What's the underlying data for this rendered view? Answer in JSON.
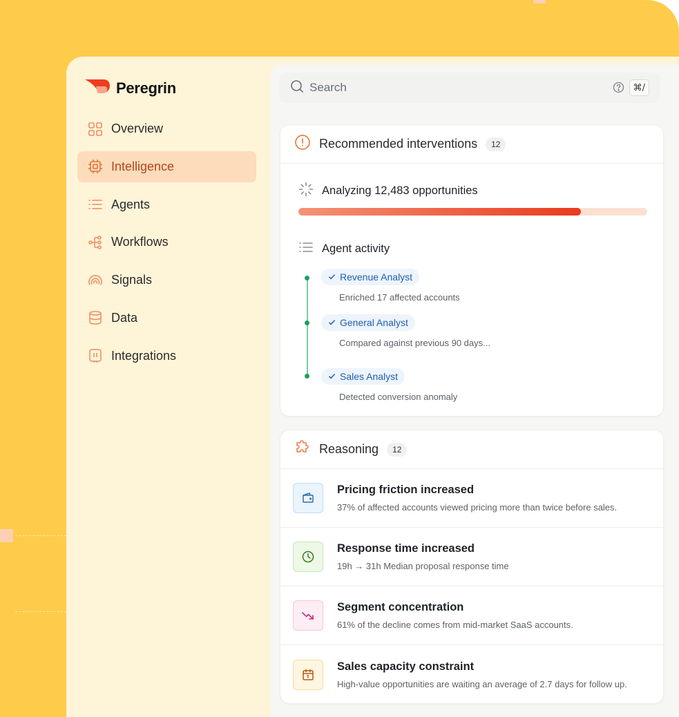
{
  "brand": {
    "name": "Peregrin"
  },
  "nav": {
    "items": [
      {
        "label": "Overview",
        "icon": "grid-icon",
        "active": false
      },
      {
        "label": "Intelligence",
        "icon": "chip-icon",
        "active": true
      },
      {
        "label": "Agents",
        "icon": "list-icon",
        "active": false
      },
      {
        "label": "Workflows",
        "icon": "workflow-icon",
        "active": false
      },
      {
        "label": "Signals",
        "icon": "signal-icon",
        "active": false
      },
      {
        "label": "Data",
        "icon": "database-icon",
        "active": false
      },
      {
        "label": "Integrations",
        "icon": "plug-icon",
        "active": false
      }
    ]
  },
  "search": {
    "placeholder": "Search",
    "shortcut": "⌘/"
  },
  "interventions": {
    "title": "Recommended interventions",
    "count": "12",
    "analyzing": "Analyzing 12,483 opportunities",
    "progress": 0.81,
    "activity_title": "Agent activity",
    "agents": [
      {
        "name": "Revenue Analyst",
        "detail": "Enriched 17 affected accounts"
      },
      {
        "name": "General Analyst",
        "detail": "Compared against previous 90 days..."
      },
      {
        "name": "Sales Analyst",
        "detail": "Detected conversion anomaly"
      }
    ]
  },
  "reasoning": {
    "title": "Reasoning",
    "count": "12",
    "items": [
      {
        "title": "Pricing friction increased",
        "detail": "37% of affected accounts viewed pricing more than twice before  sales.",
        "icon": "wallet-icon"
      },
      {
        "title": "Response time increased",
        "detail": "19h → 31h Median proposal response time",
        "icon": "clock-icon"
      },
      {
        "title": "Segment concentration",
        "detail": "61% of the decline comes from mid-market SaaS accounts.",
        "icon": "trend-down-icon"
      },
      {
        "title": "Sales capacity constraint",
        "detail": "High-value opportunities are waiting an average of 2.7 days for follow up.",
        "icon": "calendar-icon"
      }
    ]
  },
  "colors": {
    "background": "#FFCB4A",
    "accent": "#E93A1E",
    "active_nav": "#FCDCBA",
    "success": "#1E9E63"
  }
}
